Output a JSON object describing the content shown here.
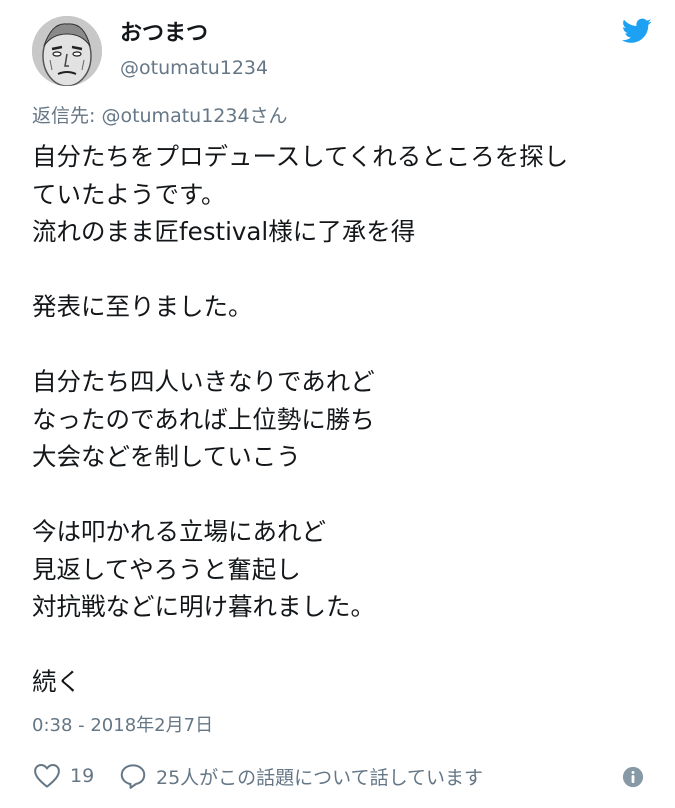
{
  "user": {
    "display_name": "おつまつ",
    "screen_name": "@otumatu1234"
  },
  "reply_to": "返信先: @otumatu1234さん",
  "tweet_lines": [
    "自分たちをプロデュースしてくれるところを探し",
    "ていたようです。",
    "流れのまま匠festival様に了承を得",
    "",
    "発表に至りました。",
    "",
    "自分たち四人いきなりであれど",
    "なったのであれば上位勢に勝ち",
    "大会などを制していこう",
    "",
    "今は叩かれる立場にあれど",
    "見返してやろうと奮起し",
    "対抗戦などに明け暮れました。",
    "",
    "続く"
  ],
  "timestamp": "0:38 - 2018年2月7日",
  "actions": {
    "like_count": "19",
    "reply_text": "25人がこの話題について話しています"
  },
  "colors": {
    "twitter_blue": "#1da1f2",
    "text_primary": "#14171a",
    "text_secondary": "#657786"
  },
  "icons": {
    "logo": "twitter-bird-icon",
    "like": "heart-icon",
    "reply": "speech-bubble-icon",
    "info": "info-icon"
  }
}
